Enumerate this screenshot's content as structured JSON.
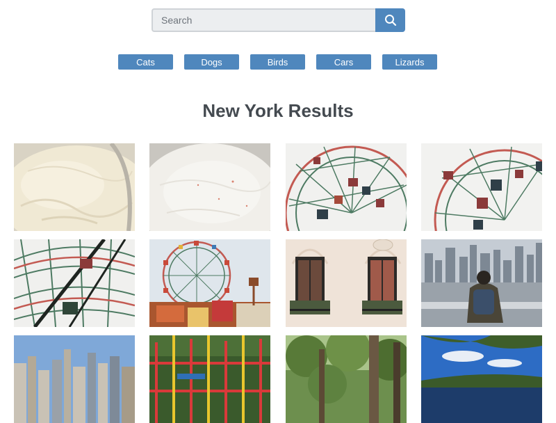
{
  "search": {
    "placeholder": "Search",
    "value": ""
  },
  "categories": [
    "Cats",
    "Dogs",
    "Birds",
    "Cars",
    "Lizards"
  ],
  "results_title": "New York Results",
  "theme": {
    "accent": "#4f87bd"
  }
}
